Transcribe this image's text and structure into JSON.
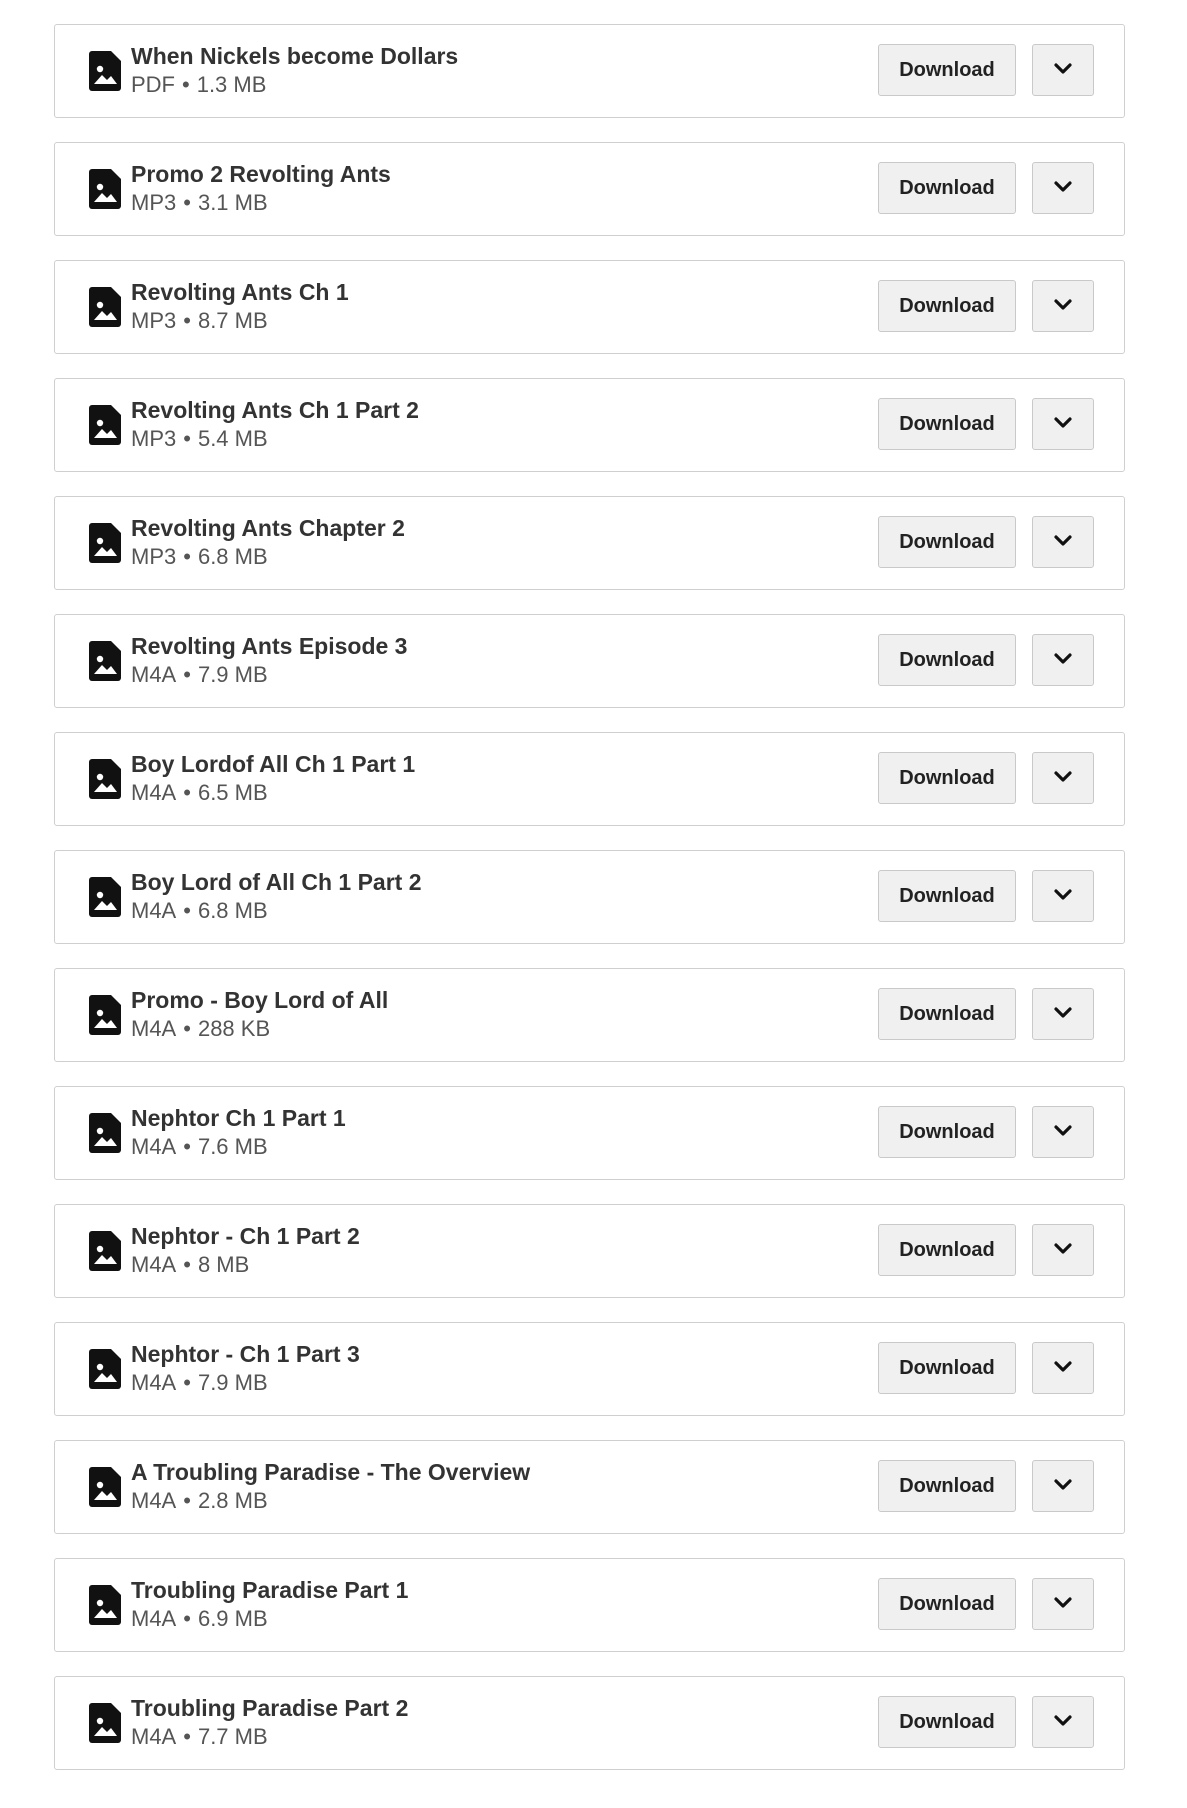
{
  "files": [
    {
      "title": "When Nickels become Dollars",
      "type": "PDF",
      "size": "1.3 MB",
      "download_label": "Download"
    },
    {
      "title": "Promo 2 Revolting Ants",
      "type": "MP3",
      "size": "3.1 MB",
      "download_label": "Download"
    },
    {
      "title": "Revolting Ants Ch 1",
      "type": "MP3",
      "size": "8.7 MB",
      "download_label": "Download"
    },
    {
      "title": "Revolting Ants Ch 1 Part 2",
      "type": "MP3",
      "size": "5.4 MB",
      "download_label": "Download"
    },
    {
      "title": "Revolting Ants Chapter 2",
      "type": "MP3",
      "size": "6.8 MB",
      "download_label": "Download"
    },
    {
      "title": "Revolting Ants Episode 3",
      "type": "M4A",
      "size": "7.9 MB",
      "download_label": "Download"
    },
    {
      "title": "Boy Lordof All Ch 1 Part 1",
      "type": "M4A",
      "size": "6.5 MB",
      "download_label": "Download"
    },
    {
      "title": "Boy Lord of All Ch 1 Part 2",
      "type": "M4A",
      "size": "6.8 MB",
      "download_label": "Download"
    },
    {
      "title": "Promo - Boy Lord of All",
      "type": "M4A",
      "size": "288 KB",
      "download_label": "Download"
    },
    {
      "title": "Nephtor Ch 1 Part 1",
      "type": "M4A",
      "size": "7.6 MB",
      "download_label": "Download"
    },
    {
      "title": "Nephtor - Ch 1 Part 2",
      "type": "M4A",
      "size": "8 MB",
      "download_label": "Download"
    },
    {
      "title": "Nephtor - Ch 1 Part 3",
      "type": "M4A",
      "size": "7.9 MB",
      "download_label": "Download"
    },
    {
      "title": "A Troubling Paradise - The Overview",
      "type": "M4A",
      "size": "2.8 MB",
      "download_label": "Download"
    },
    {
      "title": "Troubling Paradise Part 1",
      "type": "M4A",
      "size": "6.9 MB",
      "download_label": "Download"
    },
    {
      "title": "Troubling Paradise Part 2",
      "type": "M4A",
      "size": "7.7 MB",
      "download_label": "Download"
    }
  ],
  "separator": "•",
  "icons": {
    "file": "file-image-icon",
    "menu": "chevron-down-icon"
  }
}
